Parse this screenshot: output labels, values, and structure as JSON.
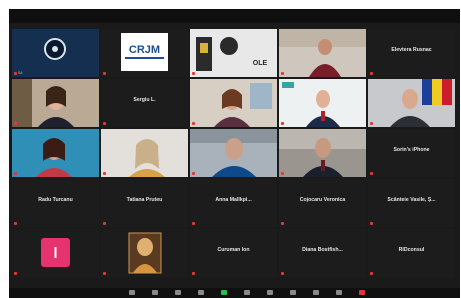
{
  "app": {
    "name": "Zoom meeting (gallery view)"
  },
  "participants": [
    {
      "display": "",
      "label": "SA"
    },
    {
      "display": "",
      "label": "CRJM"
    },
    {
      "display": "",
      "label": "OLE"
    },
    {
      "display": "",
      "label": ""
    },
    {
      "display": "Elevtera Rusnac",
      "label": ""
    },
    {
      "display": "",
      "label": ""
    },
    {
      "display": "Sergiu L.",
      "label": ""
    },
    {
      "display": "",
      "label": ""
    },
    {
      "display": "",
      "label": ""
    },
    {
      "display": "",
      "label": ""
    },
    {
      "display": "",
      "label": ""
    },
    {
      "display": "",
      "label": ""
    },
    {
      "display": "",
      "label": ""
    },
    {
      "display": "",
      "label": ""
    },
    {
      "display": "Sorin's iPhone",
      "label": ""
    },
    {
      "display": "Radu Turcanu",
      "label": ""
    },
    {
      "display": "Tatiana Pruteu",
      "label": ""
    },
    {
      "display": "Anna Mallkpi...",
      "label": ""
    },
    {
      "display": "Cojocaru Veronica",
      "label": ""
    },
    {
      "display": "Scânteie Vasile, Ș...",
      "label": ""
    },
    {
      "display": "",
      "label": ""
    },
    {
      "display": "",
      "label": ""
    },
    {
      "display": "Curuman Ion",
      "label": ""
    },
    {
      "display": "Diana Bostfish...",
      "label": ""
    },
    {
      "display": "RIDconsul",
      "label": ""
    }
  ],
  "colors": {
    "speaker_highlight": "#f0d000",
    "muted_mic": "#e33333",
    "video_on_icon": "#23c24f",
    "leave_icon": "#d83838"
  },
  "toolbar": {
    "icons": [
      "mic-icon",
      "video-icon",
      "security-icon",
      "participants-icon",
      "chat-icon",
      "share-screen-icon",
      "record-icon",
      "reactions-icon",
      "apps-icon",
      "more-icon",
      "leave-icon"
    ]
  }
}
